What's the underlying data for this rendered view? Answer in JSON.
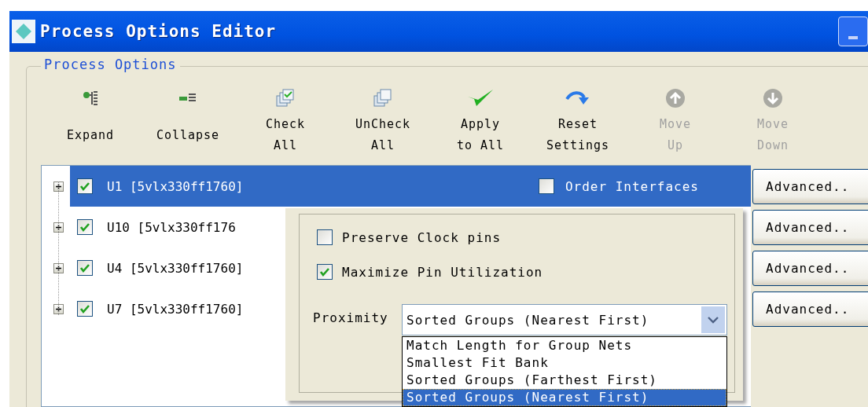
{
  "window": {
    "title": "Process Options Editor"
  },
  "group": {
    "title": "Process Options"
  },
  "toolbar": [
    {
      "label": "Expand",
      "disabled": false
    },
    {
      "label": "Collapse",
      "disabled": false
    },
    {
      "label": "Check\nAll",
      "disabled": false
    },
    {
      "label": "UnCheck\nAll",
      "disabled": false
    },
    {
      "label": "Apply\nto All",
      "disabled": false
    },
    {
      "label": "Reset\nSettings",
      "disabled": false
    },
    {
      "label": "Move\nUp",
      "disabled": true
    },
    {
      "label": "Move\nDown",
      "disabled": true
    }
  ],
  "tree": [
    {
      "label": "U1 [5vlx330ff1760]",
      "checked": true,
      "selected": true,
      "option": {
        "label": "Order Interfaces",
        "checked": false
      },
      "button": "Advanced.."
    },
    {
      "label": "U10 [5vlx330ff176",
      "checked": true,
      "selected": false,
      "button": "Advanced.."
    },
    {
      "label": "U4 [5vlx330ff1760]",
      "checked": true,
      "selected": false,
      "button": "Advanced.."
    },
    {
      "label": "U7 [5vlx330ff1760]",
      "checked": true,
      "selected": false,
      "button": "Advanced.."
    }
  ],
  "popup": {
    "options": [
      {
        "label": "Preserve Clock pins",
        "checked": false
      },
      {
        "label": "Maximize Pin Utilization",
        "checked": true
      }
    ],
    "proximity": {
      "label": "Proximity",
      "value": "Sorted Groups (Nearest First)",
      "options": [
        {
          "label": "Match Length for Group Nets",
          "selected": false
        },
        {
          "label": "Smallest Fit Bank",
          "selected": false
        },
        {
          "label": "Sorted Groups (Farthest First)",
          "selected": false
        },
        {
          "label": "Sorted Groups (Nearest First)",
          "selected": true
        }
      ]
    }
  }
}
